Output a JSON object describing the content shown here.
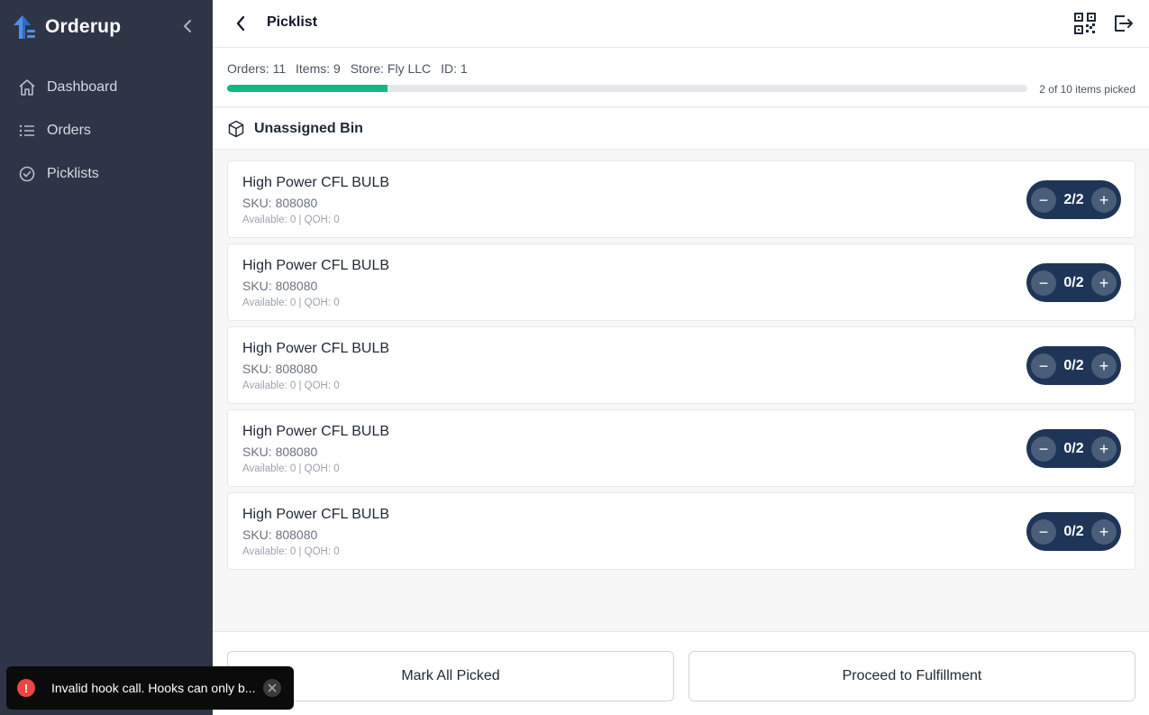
{
  "app": {
    "name": "Orderup"
  },
  "sidebar": {
    "items": [
      {
        "label": "Dashboard",
        "icon": "home-icon"
      },
      {
        "label": "Orders",
        "icon": "list-icon"
      },
      {
        "label": "Picklists",
        "icon": "check-circle-icon"
      }
    ]
  },
  "header": {
    "title": "Picklist"
  },
  "summary": {
    "orders": "Orders: 11",
    "items": "Items: 9",
    "store": "Store: Fly LLC",
    "id": "ID: 1",
    "progress_text": "2 of 10 items picked",
    "progress_fraction": 0.2
  },
  "bin": {
    "label": "Unassigned Bin"
  },
  "items": [
    {
      "name": "High Power CFL BULB",
      "sku": "SKU: 808080",
      "availability": "Available: 0 | QOH: 0",
      "qty": "2/2"
    },
    {
      "name": "High Power CFL BULB",
      "sku": "SKU: 808080",
      "availability": "Available: 0 | QOH: 0",
      "qty": "0/2"
    },
    {
      "name": "High Power CFL BULB",
      "sku": "SKU: 808080",
      "availability": "Available: 0 | QOH: 0",
      "qty": "0/2"
    },
    {
      "name": "High Power CFL BULB",
      "sku": "SKU: 808080",
      "availability": "Available: 0 | QOH: 0",
      "qty": "0/2"
    },
    {
      "name": "High Power CFL BULB",
      "sku": "SKU: 808080",
      "availability": "Available: 0 | QOH: 0",
      "qty": "0/2"
    }
  ],
  "footer": {
    "mark_all": "Mark All Picked",
    "proceed": "Proceed to Fulfillment"
  },
  "toast": {
    "message": "Invalid hook call. Hooks can only b..."
  },
  "colors": {
    "sidebar": "#2e3546",
    "accent": "#10b981",
    "stepper": "#1e3557",
    "error": "#ef4444"
  }
}
